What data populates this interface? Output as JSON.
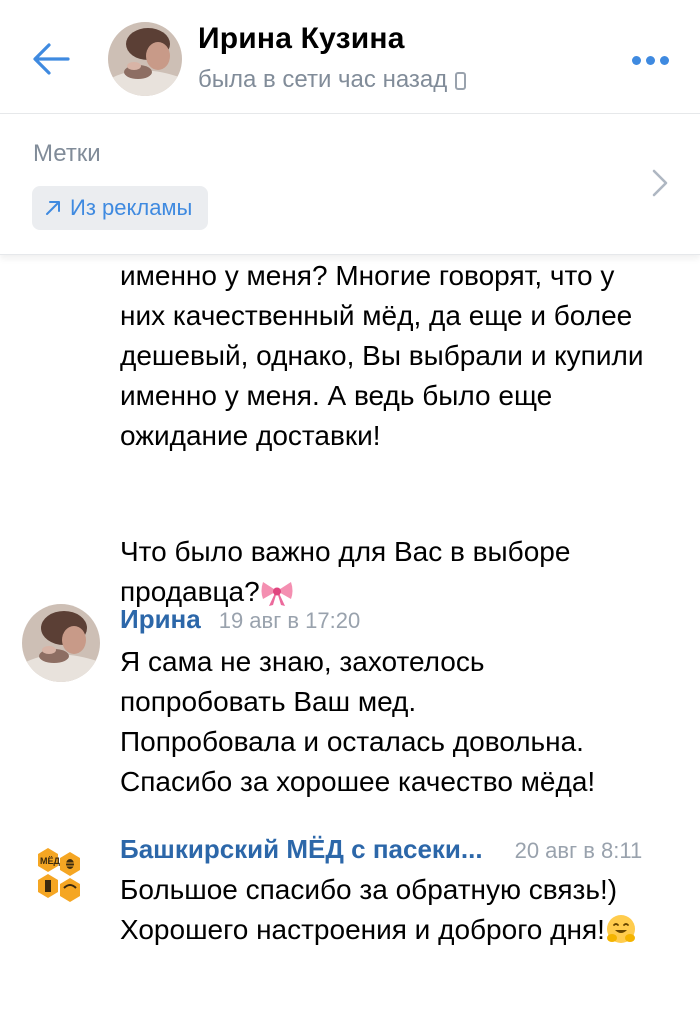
{
  "header": {
    "contact_name": "Ирина Кузина",
    "status": "была в сети час назад",
    "back_icon": "arrow-left-icon",
    "more_icon": "more-horizontal-icon",
    "status_device_icon": "phone-icon"
  },
  "tags": {
    "title": "Метки",
    "chip_label": "Из рекламы",
    "chip_icon": "arrow-up-right-icon"
  },
  "messages": [
    {
      "lines": [
        "именно у меня? Многие говорят, что у",
        "них качественный мёд, да еще и более",
        "дешевый, однако, Вы выбрали и купили",
        "именно у меня. А ведь было еще",
        "ожидание доставки!",
        "",
        "Что было важно для Вас в выборе",
        "продавца?"
      ],
      "trailing_emoji": "bow-emoji"
    },
    {
      "sender": "Ирина",
      "time": "19 авг в 17:20",
      "lines": [
        "Я сама не знаю, захотелось",
        "попробовать Ваш мед.",
        "Попробовала и осталась довольна.",
        "Спасибо за хорошее качество мёда!"
      ]
    },
    {
      "sender": "Башкирский МЁД с пасеки...",
      "time": "20 авг в 8:11",
      "lines": [
        "Большое спасибо за обратную связь!)",
        "Хорошего настроения и доброго дня!"
      ],
      "trailing_emoji": "hugging-face-emoji",
      "avatar_text": "МЁД"
    }
  ],
  "colors": {
    "accent": "#3f8ae0",
    "sender_name": "#2c67a9",
    "secondary_text": "#818c99",
    "chip_bg": "#ebedf0",
    "honey": "#f5a623"
  }
}
